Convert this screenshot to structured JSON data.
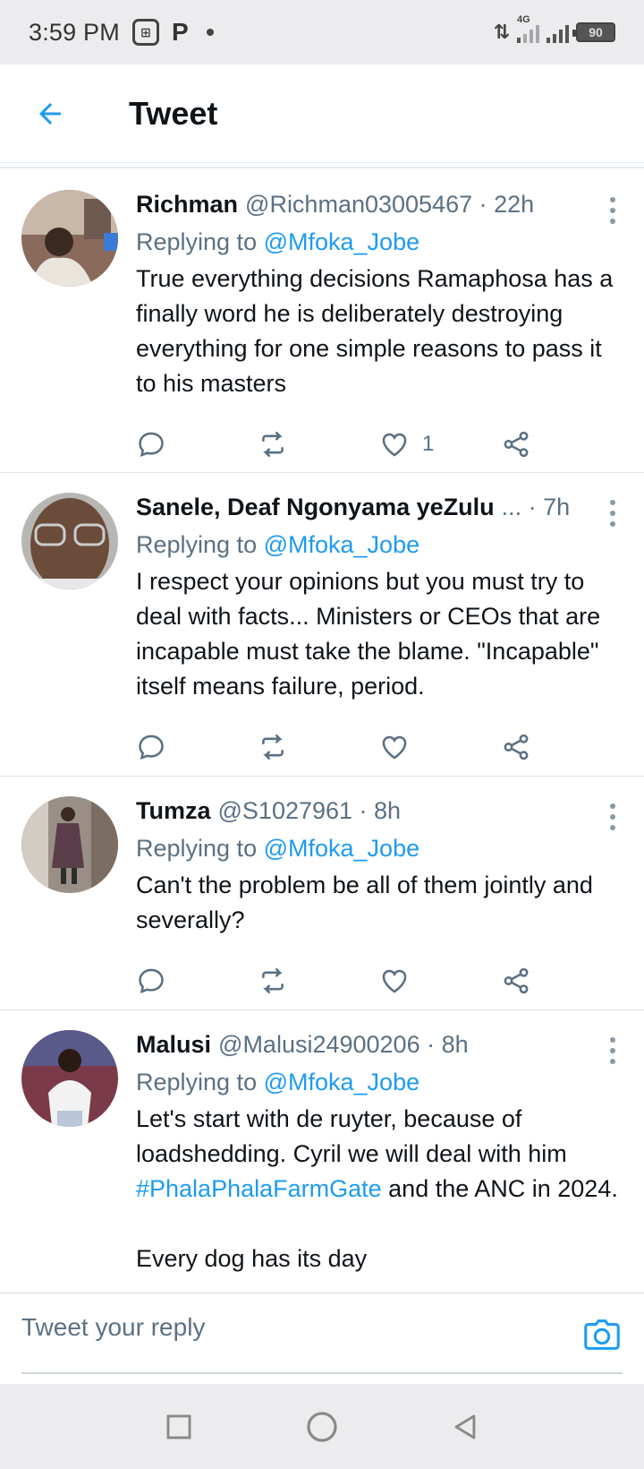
{
  "status_bar": {
    "time": "3:59 PM",
    "network": "4G",
    "battery": "90"
  },
  "header": {
    "title": "Tweet"
  },
  "tweets": [
    {
      "name": "Richman",
      "handle": "@Richman03005467 · 22h",
      "reply_prefix": "Replying to",
      "reply_to": "@Mfoka_Jobe",
      "text": "True everything decisions Ramaphosa has a finally word he is deliberately destroying everything for one simple reasons to pass it to his masters",
      "likes": "1"
    },
    {
      "name": "Sanele, Deaf Ngonyama yeZulu",
      "handle": "... · 7h",
      "reply_prefix": "Replying to",
      "reply_to": "@Mfoka_Jobe",
      "text": "I respect your opinions but you must try to deal with facts... Ministers or CEOs that are incapable must take the blame. \"Incapable\" itself means failure, period.",
      "likes": ""
    },
    {
      "name": "Tumza",
      "handle": "@S1027961 · 8h",
      "reply_prefix": "Replying to",
      "reply_to": "@Mfoka_Jobe",
      "text": "Can't the problem be all of them jointly and severally?",
      "likes": ""
    },
    {
      "name": "Malusi",
      "handle": "@Malusi24900206 · 8h",
      "reply_prefix": "Replying to",
      "reply_to": "@Mfoka_Jobe",
      "text_before": "Let's start with de ruyter, because of loadshedding. Cyril we will deal with him ",
      "hashtag": "#PhalaPhalaFarmGate",
      "text_after": " and the ANC in 2024.",
      "text_more": "Every dog has its day",
      "likes": ""
    }
  ],
  "reply_bar": {
    "placeholder": "Tweet your reply"
  },
  "colors": {
    "accent": "#1d9bf0",
    "secondary_text": "#5b7083"
  },
  "icons": [
    "back-arrow-icon",
    "more-vertical-icon",
    "reply-icon",
    "retweet-icon",
    "like-icon",
    "share-icon",
    "camera-icon",
    "nav-recents-icon",
    "nav-home-icon",
    "nav-back-icon"
  ]
}
